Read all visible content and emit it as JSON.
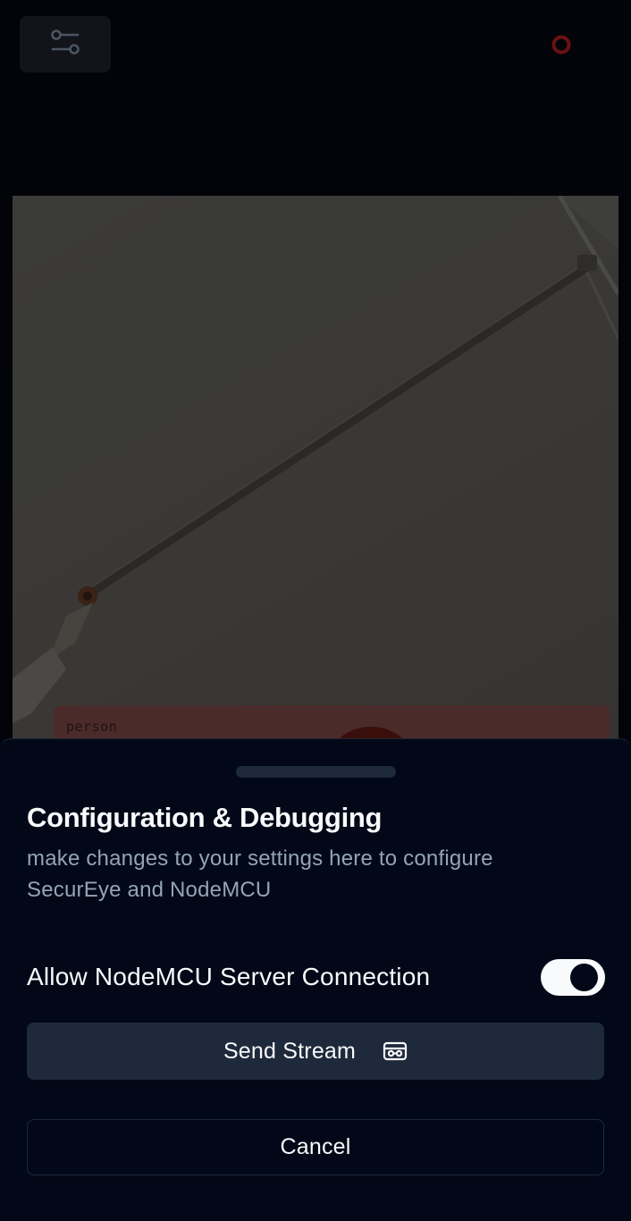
{
  "header": {
    "settings_icon": "sliders-icon",
    "status_icon": "recording-indicator-icon",
    "status_color": "#7f1d1d"
  },
  "feed": {
    "detection_label": "person",
    "detection_color": "#4a2b2a"
  },
  "sheet": {
    "title": "Configuration & Debugging",
    "description": "make changes to your settings here to configure SecurEye and NodeMCU",
    "toggle": {
      "label": "Allow NodeMCU Server Connection",
      "enabled": true
    },
    "send_button": {
      "label": "Send Stream",
      "icon": "projector-icon"
    },
    "cancel_button": {
      "label": "Cancel"
    }
  },
  "colors": {
    "background": "#020409",
    "sheet": "#020817",
    "button": "#1e293b",
    "text": "#f8fafc",
    "muted": "#94a3b8"
  }
}
